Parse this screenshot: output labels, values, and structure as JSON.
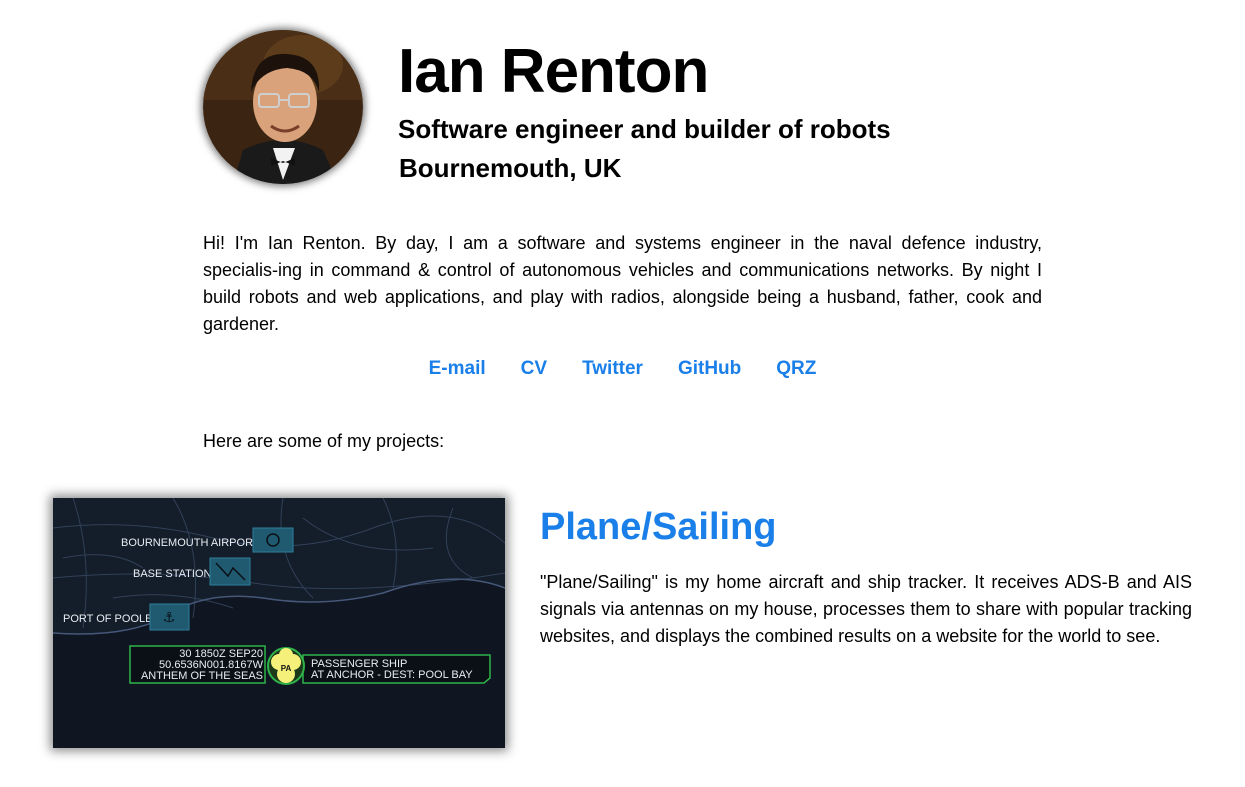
{
  "header": {
    "name": "Ian Renton",
    "tagline": "Software engineer and builder of robots",
    "location": "Bournemouth, UK"
  },
  "intro": "Hi! I'm Ian Renton. By day, I am a software and systems engineer in the naval defence industry, specialis-ing in command & control of autonomous vehicles and communications networks. By night I build robots and web applications, and play with radios, alongside being a husband, father, cook and gardener.",
  "links": [
    {
      "label": "E-mail"
    },
    {
      "label": "CV"
    },
    {
      "label": "Twitter"
    },
    {
      "label": "GitHub"
    },
    {
      "label": "QRZ"
    }
  ],
  "projects_intro": "Here are some of my projects:",
  "projects": [
    {
      "title": "Plane/Sailing",
      "description": "\"Plane/Sailing\" is my home aircraft and ship tracker. It receives ADS-B and AIS signals via antennas on my house, processes them to share with popular tracking websites, and displays the combined results on a website for the world to see.",
      "map": {
        "labels": {
          "airport": "BOURNEMOUTH AIRPORT",
          "base_station": "BASE STATION",
          "port": "PORT OF POOLE"
        },
        "ship_info_left": [
          "30 1850Z SEP20",
          "50.6536N001.8167W",
          "ANTHEM OF THE SEAS"
        ],
        "ship_info_right": [
          "PASSENGER SHIP",
          "AT ANCHOR - DEST: POOL BAY"
        ],
        "ship_marker": "PA"
      }
    }
  ],
  "colors": {
    "link": "#1a7fe8",
    "map_background": "#0f1621",
    "map_marker": "#1f5a70",
    "ship_highlight": "#2fb34a",
    "ship_marker": "#f4f07a"
  }
}
